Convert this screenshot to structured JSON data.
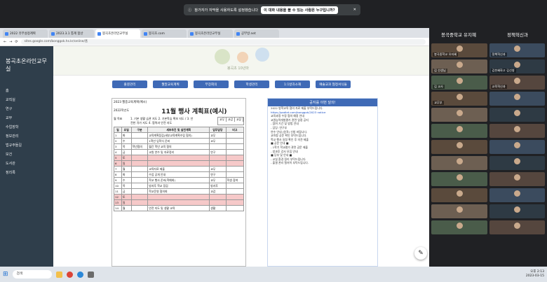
{
  "notice": {
    "text": "참가자가 자막을 사용하도록 설정했습니다",
    "question": "이 대화 내용을 볼 수 있는 사람은 누구입니까?"
  },
  "browser": {
    "tabs": [
      "2022 유무설정계획",
      "2023.3.1 통계 합산",
      "봉곡초온라인교무실",
      "봉곡초.com",
      "봉곡초온라인교무실",
      "공부방.net"
    ],
    "url": "sites.google.com/bonggok.hs.kr/online/홈"
  },
  "site": {
    "title": "봉곡초온라인교무실",
    "nav": [
      "홈",
      "교직실",
      "연구",
      "교무",
      "수업장학",
      "정보관리",
      "법규주들길",
      "보건",
      "도서관",
      "정리록"
    ]
  },
  "banner": {
    "text": "봉곡초 10년마"
  },
  "buttons": [
    "출결관리",
    "월말교육계획",
    "부장회의",
    "학생관리",
    "1:1방과소재",
    "예술교과 협정서식들"
  ],
  "doc": {
    "top": "2023 월중교육계획(예시)",
    "date_label": "2022학년도",
    "title": "11월 행사 계획표(예시)",
    "goal_label": "월 목표",
    "goals": "1. 기본 생활 습관 지도  2. 기본학습 확보 지도 / 3. 안전한 귀가 지도  4. 협력과 안전 지도",
    "sign": [
      "교무",
      "교감",
      "교장"
    ],
    "headers": [
      "일",
      "요일",
      "구분",
      "세부추진 및 실천계획",
      "업무담당",
      "비고"
    ],
    "rows": [
      [
        "1",
        "화",
        "",
        "교육계획점검(세부교육계획수립 협의)",
        "교무",
        ""
      ],
      [
        "2",
        "수",
        "",
        "1학년 입학식 준비",
        "교무",
        ""
      ],
      [
        "3",
        "목",
        "학년협의",
        "월간 학년 교육 협의",
        "",
        ""
      ],
      [
        "4",
        "금",
        "",
        "교원 연수 및 자료정리",
        "연구",
        ""
      ],
      [
        "5",
        "토",
        "",
        "",
        "",
        ""
      ],
      [
        "6",
        "일",
        "",
        "",
        "",
        ""
      ],
      [
        "7",
        "월",
        "",
        "교육자료 제출",
        "교무",
        ""
      ],
      [
        "8",
        "화",
        "",
        "수업 공개 안내",
        "연구",
        ""
      ],
      [
        "9",
        "수",
        "",
        "학교 행사 준비(학예회)",
        "교무",
        "학생 참여"
      ],
      [
        "10",
        "목",
        "",
        "방과후 학교 점검",
        "방과후",
        ""
      ],
      [
        "11",
        "금",
        "",
        "학교운영 협의회",
        "교감",
        ""
      ],
      [
        "12",
        "토",
        "",
        "",
        "",
        ""
      ],
      [
        "13",
        "일",
        "",
        "",
        "",
        ""
      ],
      [
        "14",
        "월",
        "",
        "안전 지도 및 생활 교육",
        "생활",
        ""
      ]
    ],
    "weekend": [
      4,
      5,
      11,
      12
    ]
  },
  "notices": {
    "title": "공지를 이번 달의!",
    "lines": [
      "2022 방학교육 협의 자료 제출 부탁드립니다.",
      "https://padlet.com/bonggok/2023 notice",
      "교육과정 수정 협의 예정 안내",
      "교원능력개발평가 관련 일정 공지",
      "- 참여 기간 및 방법 안내",
      "- 담당: 연구부",
      "연수 안내 (원격) 신청 바랍니다.",
      "교육청 공문 확인 부탁드립니다.",
      "학교 행사 일정 확인 후 의견 제출",
      "■ 공문 안내 ■",
      "- 1학기 학교평가 관련 공문 제출",
      "- 방과후 강사 모집 안내",
      "■ 당부 및 안내 ■",
      "- 교실 환경 정리 부탁드립니다.",
      "- 출결 관리 철저히 부탁드립니다."
    ]
  },
  "taskbar": {
    "search": "검색",
    "time": "오후 2:13",
    "date": "2023-03-15"
  },
  "participants": {
    "headers": [
      "봉곡중학교 유지혜",
      "정책혁신과"
    ],
    "names": [
      "봉곡중학교 유지혜",
      "정책혁신과",
      "김 선생님",
      "김천혜화고 김선영",
      "김 교사",
      "교육혁신과",
      "교무부",
      "",
      "",
      "",
      "",
      "",
      "",
      "",
      "",
      "",
      "",
      "",
      "",
      "",
      "",
      "",
      "",
      ""
    ]
  }
}
